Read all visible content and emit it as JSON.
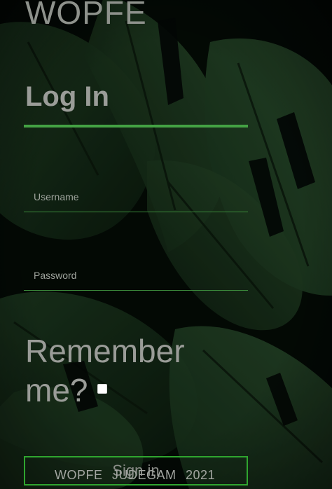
{
  "brand": {
    "name": "WOPFE"
  },
  "form": {
    "heading": "Log In",
    "username": {
      "placeholder": "Username",
      "value": ""
    },
    "password": {
      "placeholder": "Password",
      "value": ""
    },
    "remember_label": "Remember me?",
    "remember_checked": false,
    "submit_label": "Sign in"
  },
  "footer": {
    "text": "WOPFE   JUDEGAM   2021"
  },
  "colors": {
    "accent": "#44a244",
    "button_border": "#2fa52f",
    "text_muted": "#9a9c98",
    "background": "#030a05"
  },
  "icons": {
    "checkbox": "checkbox-unchecked-icon"
  }
}
